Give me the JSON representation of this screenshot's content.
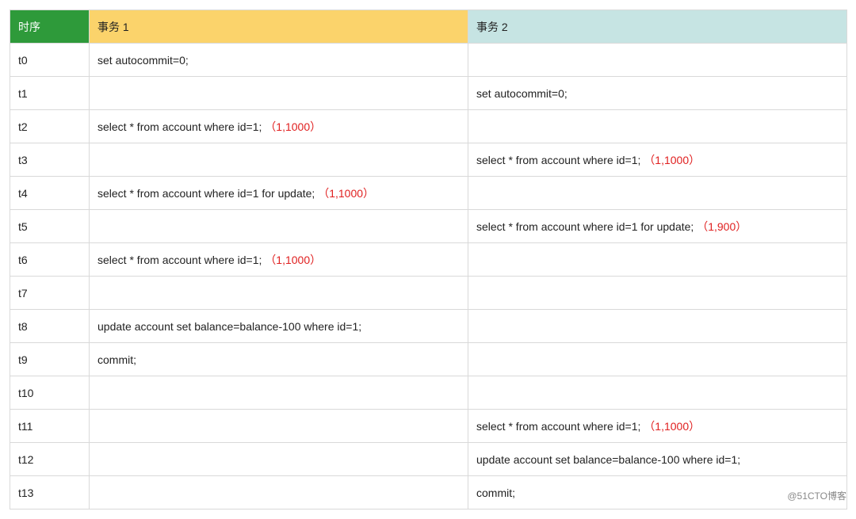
{
  "headers": {
    "time": "时序",
    "tx1": "事务 1",
    "tx2": "事务 2"
  },
  "rows": [
    {
      "time": "t0",
      "tx1": {
        "sql": "set autocommit=0;",
        "note": ""
      },
      "tx2": {
        "sql": "",
        "note": ""
      }
    },
    {
      "time": "t1",
      "tx1": {
        "sql": "",
        "note": ""
      },
      "tx2": {
        "sql": "set autocommit=0;",
        "note": ""
      }
    },
    {
      "time": "t2",
      "tx1": {
        "sql": "select * from account where id=1;",
        "note": "（1,1000）"
      },
      "tx2": {
        "sql": "",
        "note": ""
      }
    },
    {
      "time": "t3",
      "tx1": {
        "sql": "",
        "note": ""
      },
      "tx2": {
        "sql": "select * from account where id=1;",
        "note": "（1,1000）"
      }
    },
    {
      "time": "t4",
      "tx1": {
        "sql": "select * from account where id=1 for update;",
        "note": "（1,1000）"
      },
      "tx2": {
        "sql": "",
        "note": ""
      }
    },
    {
      "time": "t5",
      "tx1": {
        "sql": "",
        "note": ""
      },
      "tx2": {
        "sql": "select * from account where id=1 for update;",
        "note": "（1,900）"
      }
    },
    {
      "time": "t6",
      "tx1": {
        "sql": "select * from account where id=1;",
        "note": "（1,1000）"
      },
      "tx2": {
        "sql": "",
        "note": ""
      }
    },
    {
      "time": "t7",
      "tx1": {
        "sql": "",
        "note": ""
      },
      "tx2": {
        "sql": "",
        "note": ""
      }
    },
    {
      "time": "t8",
      "tx1": {
        "sql": "update account set balance=balance-100 where id=1;",
        "note": ""
      },
      "tx2": {
        "sql": "",
        "note": ""
      }
    },
    {
      "time": "t9",
      "tx1": {
        "sql": "commit;",
        "note": ""
      },
      "tx2": {
        "sql": "",
        "note": ""
      }
    },
    {
      "time": "t10",
      "tx1": {
        "sql": "",
        "note": ""
      },
      "tx2": {
        "sql": "",
        "note": ""
      }
    },
    {
      "time": "t11",
      "tx1": {
        "sql": "",
        "note": ""
      },
      "tx2": {
        "sql": "select * from account where id=1;",
        "note": "（1,1000）"
      }
    },
    {
      "time": "t12",
      "tx1": {
        "sql": "",
        "note": ""
      },
      "tx2": {
        "sql": "update account set balance=balance-100 where id=1;",
        "note": ""
      }
    },
    {
      "time": "t13",
      "tx1": {
        "sql": "",
        "note": ""
      },
      "tx2": {
        "sql": "commit;",
        "note": ""
      }
    }
  ],
  "watermark": "@51CTO博客"
}
